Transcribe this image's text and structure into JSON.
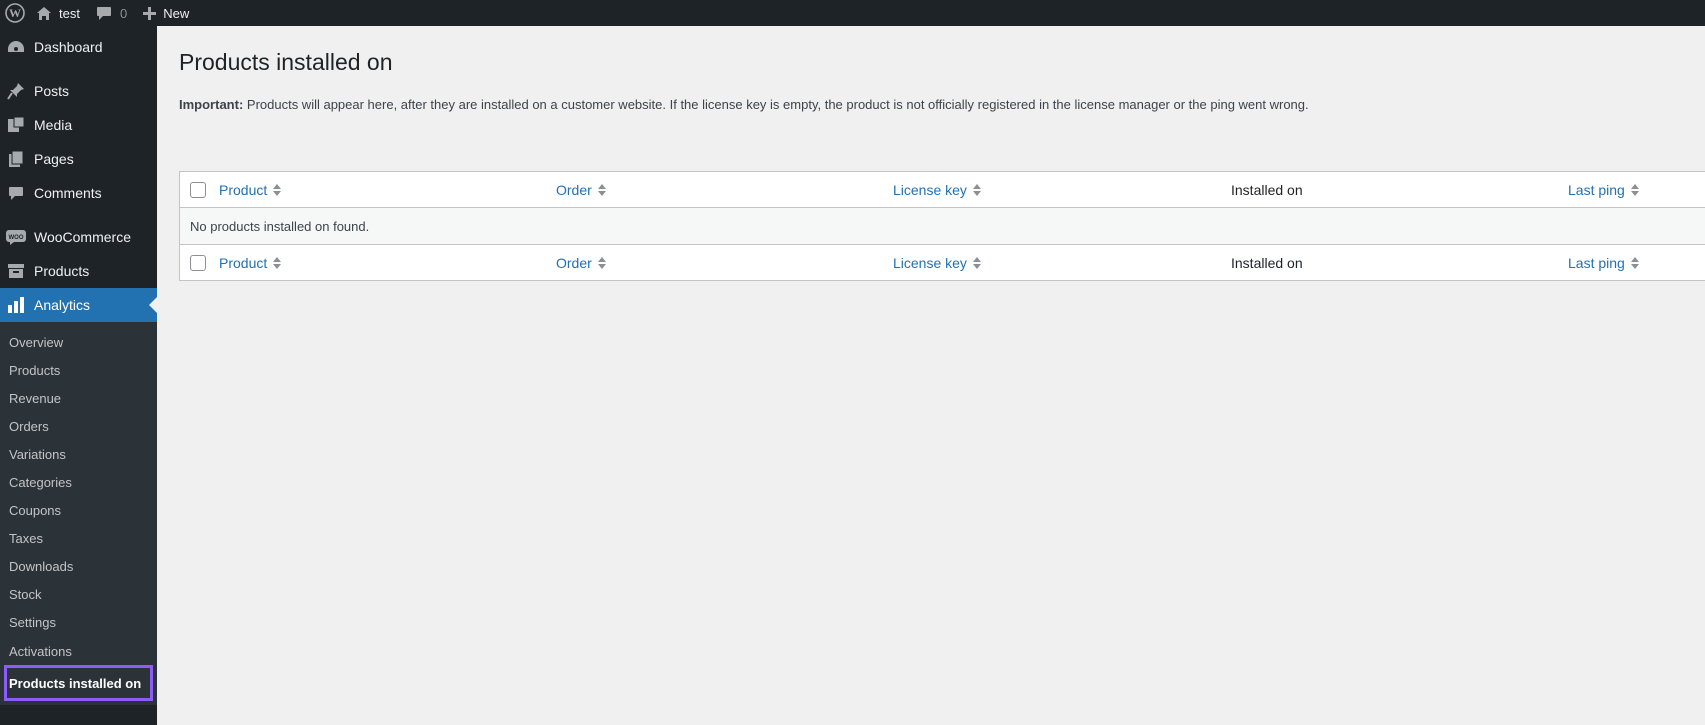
{
  "adminbar": {
    "site_name": "test",
    "comments_count": "0",
    "new_label": "New",
    "icons": [
      "wordpress-logo-icon",
      "home-icon",
      "comment-icon",
      "plus-icon"
    ]
  },
  "sidebar": {
    "items": [
      {
        "label": "Dashboard",
        "icon": "dashboard-icon"
      },
      {
        "label": "Posts",
        "icon": "pin-icon"
      },
      {
        "label": "Media",
        "icon": "media-icon"
      },
      {
        "label": "Pages",
        "icon": "pages-icon"
      },
      {
        "label": "Comments",
        "icon": "comment-icon"
      },
      {
        "label": "WooCommerce",
        "icon": "woo-icon"
      },
      {
        "label": "Products",
        "icon": "archive-icon"
      },
      {
        "label": "Analytics",
        "icon": "bar-chart-icon"
      }
    ],
    "submenu": [
      "Overview",
      "Products",
      "Revenue",
      "Orders",
      "Variations",
      "Categories",
      "Coupons",
      "Taxes",
      "Downloads",
      "Stock",
      "Settings",
      "Activations",
      "Products installed on"
    ]
  },
  "main": {
    "title": "Products installed on",
    "notice_bold": "Important:",
    "notice_text": " Products will appear here, after they are installed on a customer website. If the license key is empty, the product is not officially registered in the license manager or the ping went wrong.",
    "table": {
      "columns": [
        "Product",
        "Order",
        "License key",
        "Installed on",
        "Last ping"
      ],
      "empty_message": "No products installed on found."
    }
  },
  "colors": {
    "adminbar_bg": "#1d2327",
    "accent": "#2271b1",
    "highlight": "#8b5cf6",
    "link": "#2271b1"
  }
}
